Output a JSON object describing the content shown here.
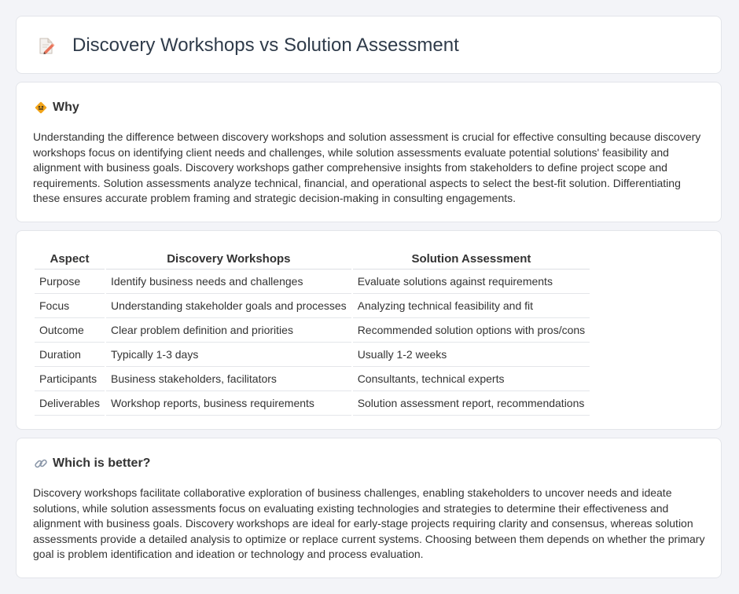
{
  "header": {
    "title": "Discovery Workshops vs Solution Assessment",
    "icon": "document-pencil-icon"
  },
  "why": {
    "title": "Why",
    "icon": "diamond-sign-icon",
    "body": "Understanding the difference between discovery workshops and solution assessment is crucial for effective consulting because discovery workshops focus on identifying client needs and challenges, while solution assessments evaluate potential solutions' feasibility and alignment with business goals. Discovery workshops gather comprehensive insights from stakeholders to define project scope and requirements. Solution assessments analyze technical, financial, and operational aspects to select the best-fit solution. Differentiating these ensures accurate problem framing and strategic decision-making in consulting engagements."
  },
  "table": {
    "headers": [
      "Aspect",
      "Discovery Workshops",
      "Solution Assessment"
    ],
    "rows": [
      [
        "Purpose",
        "Identify business needs and challenges",
        "Evaluate solutions against requirements"
      ],
      [
        "Focus",
        "Understanding stakeholder goals and processes",
        "Analyzing technical feasibility and fit"
      ],
      [
        "Outcome",
        "Clear problem definition and priorities",
        "Recommended solution options with pros/cons"
      ],
      [
        "Duration",
        "Typically 1-3 days",
        "Usually 1-2 weeks"
      ],
      [
        "Participants",
        "Business stakeholders, facilitators",
        "Consultants, technical experts"
      ],
      [
        "Deliverables",
        "Workshop reports, business requirements",
        "Solution assessment report, recommendations"
      ]
    ]
  },
  "better": {
    "title": "Which is better?",
    "icon": "link-icon",
    "body": "Discovery workshops facilitate collaborative exploration of business challenges, enabling stakeholders to uncover needs and ideate solutions, while solution assessments focus on evaluating existing technologies and strategies to determine their effectiveness and alignment with business goals. Discovery workshops are ideal for early-stage projects requiring clarity and consensus, whereas solution assessments provide a detailed analysis to optimize or replace current systems. Choosing between them depends on whether the primary goal is problem identification and ideation or technology and process evaluation."
  }
}
